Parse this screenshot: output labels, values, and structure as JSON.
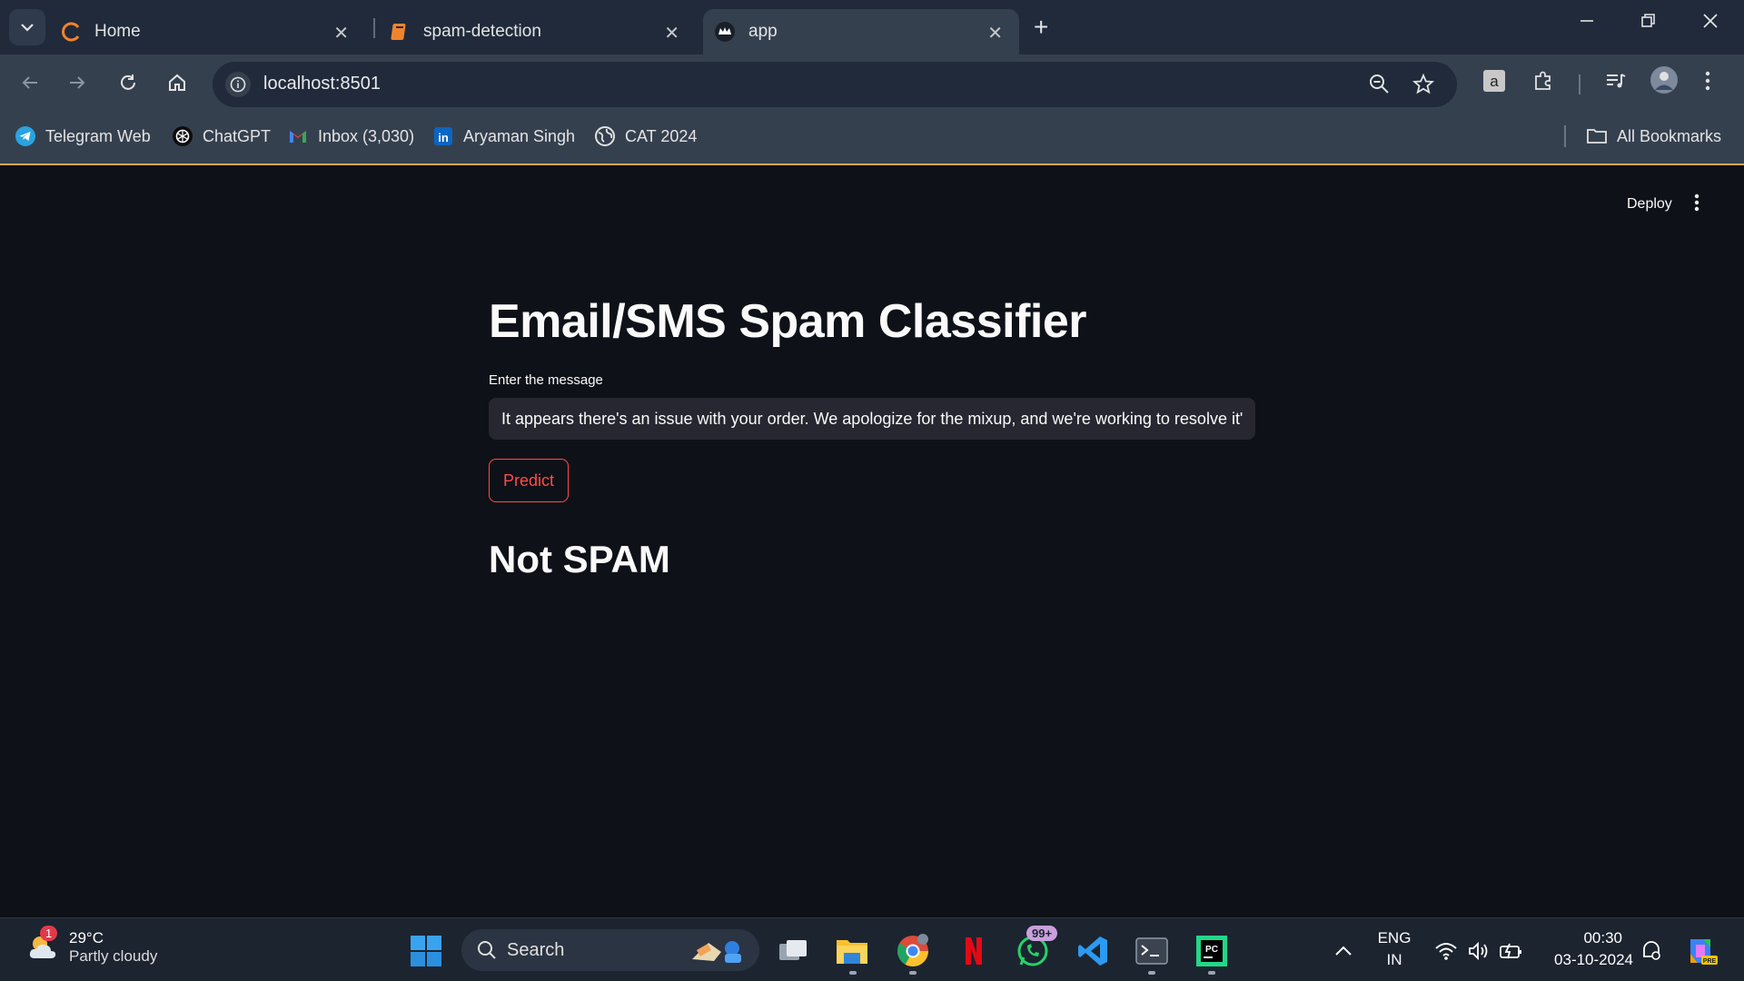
{
  "browser": {
    "tabs": [
      {
        "label": "Home",
        "active": false
      },
      {
        "label": "spam-detection",
        "active": false
      },
      {
        "label": "app",
        "active": true
      }
    ],
    "url": "localhost:8501",
    "bookmarks": [
      {
        "label": "Telegram Web"
      },
      {
        "label": "ChatGPT"
      },
      {
        "label": "Inbox (3,030)"
      },
      {
        "label": "Aryaman Singh"
      },
      {
        "label": "CAT 2024"
      }
    ],
    "all_bookmarks_label": "All Bookmarks"
  },
  "app": {
    "deploy_label": "Deploy",
    "title": "Email/SMS Spam Classifier",
    "input_label": "Enter the message",
    "input_value": "It appears there's an issue with your order. We apologize for the mixup, and we're working to resolve it\"",
    "predict_label": "Predict",
    "result": "Not SPAM",
    "accent_color": "#ff4b4b",
    "background_color": "#0e1117"
  },
  "taskbar": {
    "weather_badge": "1",
    "temperature": "29°C",
    "condition": "Partly cloudy",
    "search_label": "Search",
    "whatsapp_badge": "99+",
    "language_top": "ENG",
    "language_bottom": "IN",
    "time": "00:30",
    "date": "03-10-2024"
  }
}
